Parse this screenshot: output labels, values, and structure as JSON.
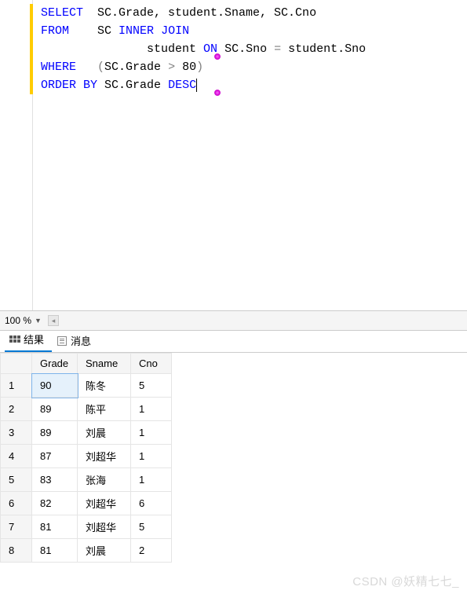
{
  "sql": {
    "line1": {
      "k1": "SELECT",
      "rest": "  SC.Grade, student.Sname, SC.Cno"
    },
    "line2": {
      "k1": "FROM",
      "gap": "    SC ",
      "k2": "INNER",
      "sp": " ",
      "k3": "JOIN"
    },
    "line3": {
      "indent": "               student ",
      "k1": "ON",
      "rest": " SC.Sno ",
      "op": "=",
      "rest2": " student.Sno"
    },
    "line4": {
      "k1": "WHERE",
      "gap": "   ",
      "p1": "(",
      "mid": "SC.Grade ",
      "op": ">",
      "rest": " 80",
      "p2": ")"
    },
    "line5": {
      "k1": "ORDER",
      "sp": " ",
      "k2": "BY",
      "mid": " SC.Grade ",
      "k3": "DESC"
    }
  },
  "zoom": {
    "value": "100 %"
  },
  "tabs": {
    "results": "结果",
    "messages": "消息"
  },
  "columns": {
    "grade": "Grade",
    "sname": "Sname",
    "cno": "Cno"
  },
  "rows": [
    {
      "n": "1",
      "grade": "90",
      "sname": "陈冬",
      "cno": "5"
    },
    {
      "n": "2",
      "grade": "89",
      "sname": "陈平",
      "cno": "1"
    },
    {
      "n": "3",
      "grade": "89",
      "sname": "刘晨",
      "cno": "1"
    },
    {
      "n": "4",
      "grade": "87",
      "sname": "刘超华",
      "cno": "1"
    },
    {
      "n": "5",
      "grade": "83",
      "sname": "张海",
      "cno": "1"
    },
    {
      "n": "6",
      "grade": "82",
      "sname": "刘超华",
      "cno": "6"
    },
    {
      "n": "7",
      "grade": "81",
      "sname": "刘超华",
      "cno": "5"
    },
    {
      "n": "8",
      "grade": "81",
      "sname": "刘晨",
      "cno": "2"
    }
  ],
  "watermark": "CSDN @妖精七七_"
}
